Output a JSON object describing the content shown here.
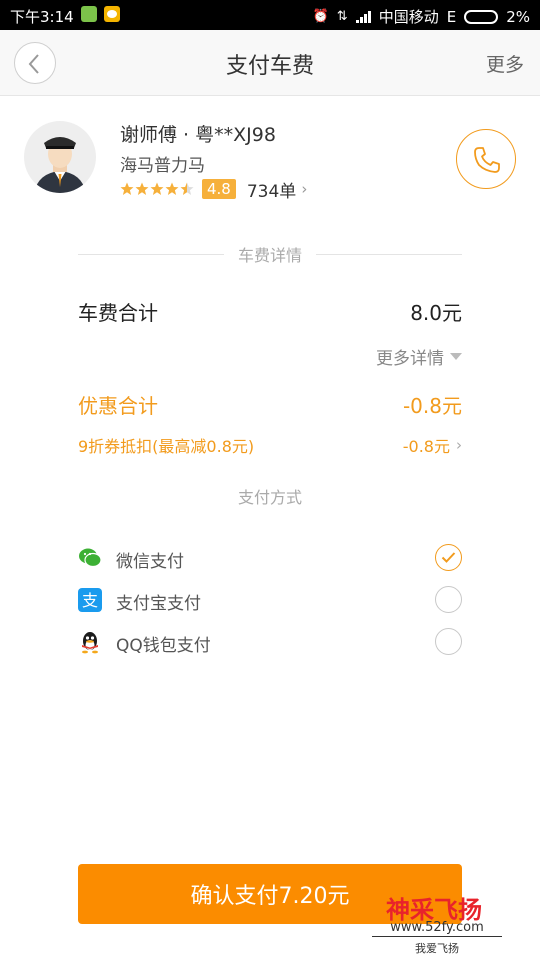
{
  "status_bar": {
    "time": "下午3:14",
    "carrier": "中国移动",
    "network": "E",
    "battery": "2%"
  },
  "header": {
    "title": "支付车费",
    "more_label": "更多"
  },
  "driver": {
    "name": "谢师傅 · 粤**XJ98",
    "car_model": "海马普力马",
    "rating_stars": 4.5,
    "rating_score": "4.8",
    "order_count": "734单"
  },
  "fee_section": {
    "title": "车费详情",
    "total_label": "车费合计",
    "total_value": "8.0元",
    "more_details_label": "更多详情",
    "discount_total_label": "优惠合计",
    "discount_total_value": "-0.8元",
    "coupon_label": "9折券抵扣(最高减0.8元)",
    "coupon_value": "-0.8元"
  },
  "payment_section": {
    "title": "支付方式",
    "methods": [
      {
        "label": "微信支付",
        "icon": "wechat-icon",
        "selected": true
      },
      {
        "label": "支付宝支付",
        "icon": "alipay-icon",
        "selected": false
      },
      {
        "label": "QQ钱包支付",
        "icon": "qq-icon",
        "selected": false
      }
    ]
  },
  "confirm_button": {
    "label": "确认支付7.20元"
  },
  "watermark": {
    "title": "神采飞扬",
    "url": "www.52fy.com",
    "subtitle": "我爱飞扬"
  },
  "colors": {
    "accent": "#f29b1d",
    "confirm_button": "#fb8c00",
    "rating_badge": "#f6b03b",
    "wechat": "#3cb034",
    "alipay": "#1a9bee",
    "watermark_red": "#e8232b"
  }
}
